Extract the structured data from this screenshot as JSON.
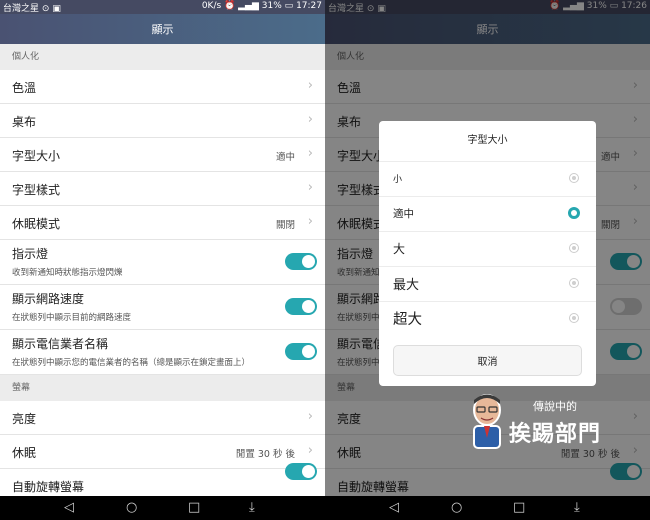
{
  "left": {
    "status": {
      "carrier": "台灣之星",
      "speed": "0K/s",
      "battery": "31%",
      "time": "17:27"
    },
    "title": "顯示",
    "sections": {
      "personal": "個人化",
      "screen": "螢幕"
    },
    "rows": {
      "color_temp": "色溫",
      "wallpaper": "桌布",
      "font_size": {
        "label": "字型大小",
        "value": "適中"
      },
      "font_style": "字型樣式",
      "sleep_mode": {
        "label": "休眠模式",
        "value": "關閉"
      },
      "indicator": {
        "label": "指示燈",
        "desc": "收到新通知時狀態指示燈閃爍",
        "on": true
      },
      "net_speed": {
        "label": "顯示網路速度",
        "desc": "在狀態列中顯示目前的網路速度",
        "on": true
      },
      "carrier_name": {
        "label": "顯示電信業者名稱",
        "desc": "在狀態列中顯示您的電信業者的名稱（總是顯示在鎖定畫面上）",
        "on": true
      },
      "brightness": "亮度",
      "sleep": {
        "label": "休眠",
        "value": "閒置 30 秒 後"
      },
      "auto_rotate": {
        "label": "自動旋轉螢幕",
        "on": true
      }
    }
  },
  "right": {
    "status": {
      "carrier": "台灣之星",
      "battery": "31%",
      "time": "17:26"
    },
    "title": "顯示",
    "sections": {
      "personal": "個人化",
      "screen": "螢幕"
    },
    "rows": {
      "color_temp": "色溫",
      "wallpaper": "桌布",
      "font_size": {
        "label": "字型大小",
        "value": "適中"
      },
      "font_style": "字型樣式",
      "sleep_mode": {
        "label": "休眠模式",
        "value": "關閉"
      },
      "indicator": {
        "label": "指示燈",
        "desc": "收到新通知",
        "on": true
      },
      "net_speed": {
        "label": "顯示網路",
        "desc": "在狀態列中",
        "on": false
      },
      "carrier_name": {
        "label": "顯示電信",
        "desc": "在狀態列中",
        "on": true
      },
      "brightness": "亮度",
      "sleep": {
        "label": "休眠",
        "value": "閒置 30 秒 後"
      },
      "auto_rotate": {
        "label": "自動旋轉螢幕",
        "on": true
      }
    },
    "dialog": {
      "title": "字型大小",
      "options": [
        {
          "label": "小",
          "selected": false
        },
        {
          "label": "適中",
          "selected": true
        },
        {
          "label": "大",
          "selected": false
        },
        {
          "label": "最大",
          "selected": false
        },
        {
          "label": "超大",
          "selected": false
        }
      ],
      "cancel": "取消"
    }
  },
  "watermark": {
    "line1": "傳說中的",
    "line2": "挨踢部門"
  },
  "colors": {
    "accent": "#26a7b0",
    "header": "#4a5272"
  },
  "icons": [
    "back-icon",
    "home-icon",
    "recents-icon",
    "notification-pull-icon",
    "chevron-right-icon"
  ]
}
